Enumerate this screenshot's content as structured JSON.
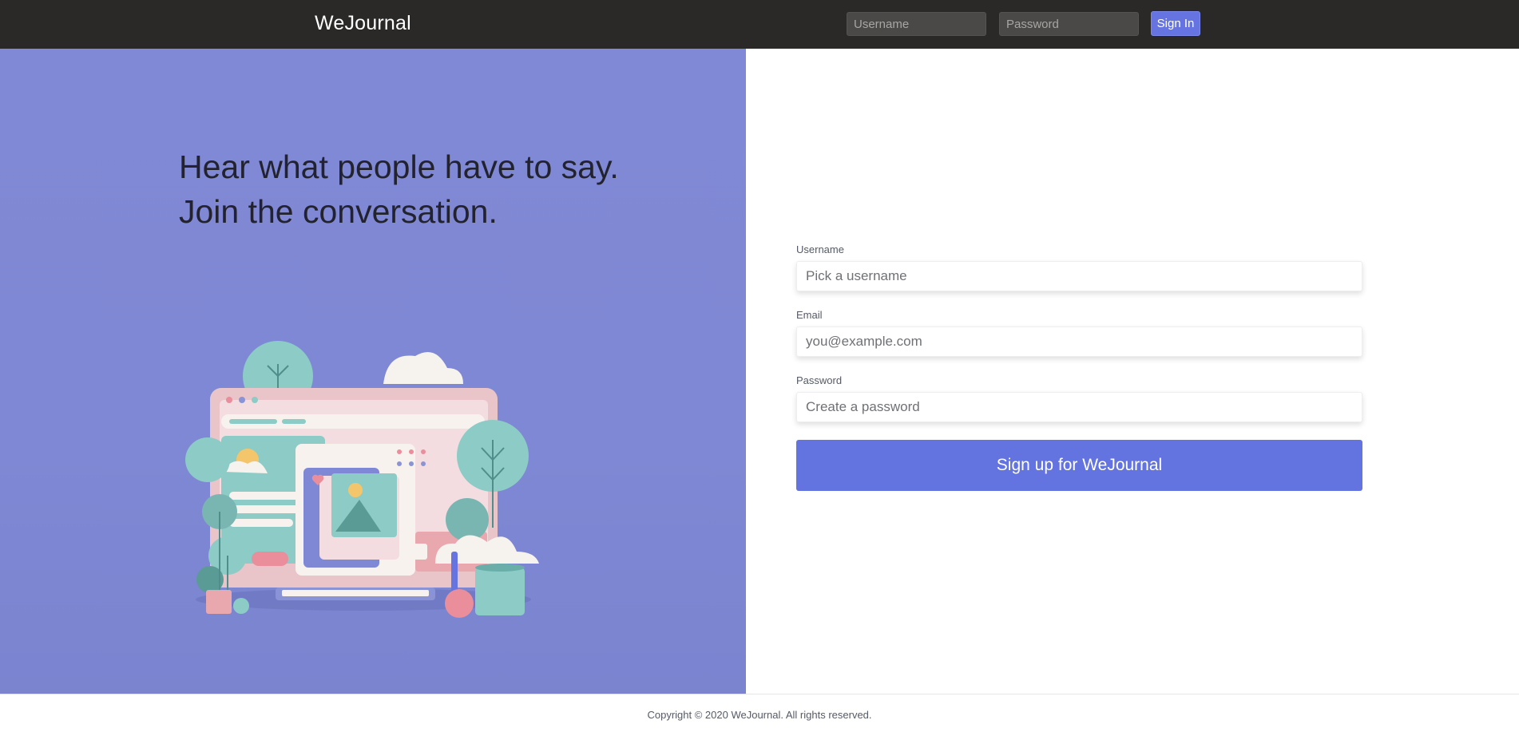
{
  "header": {
    "brand": "WeJournal",
    "username_placeholder": "Username",
    "password_placeholder": "Password",
    "signin_label": "Sign In"
  },
  "hero": {
    "line1": "Hear what people have to say.",
    "line2": "Join the conversation."
  },
  "signup": {
    "username_label": "Username",
    "username_placeholder": "Pick a username",
    "email_label": "Email",
    "email_placeholder": "you@example.com",
    "password_label": "Password",
    "password_placeholder": "Create a password",
    "submit_label": "Sign up for WeJournal"
  },
  "footer": {
    "copyright": "Copyright © 2020 WeJournal. All rights reserved."
  },
  "colors": {
    "topbar": "#2a2928",
    "hero_bg": "#8089d5",
    "accent": "#6373e0"
  }
}
